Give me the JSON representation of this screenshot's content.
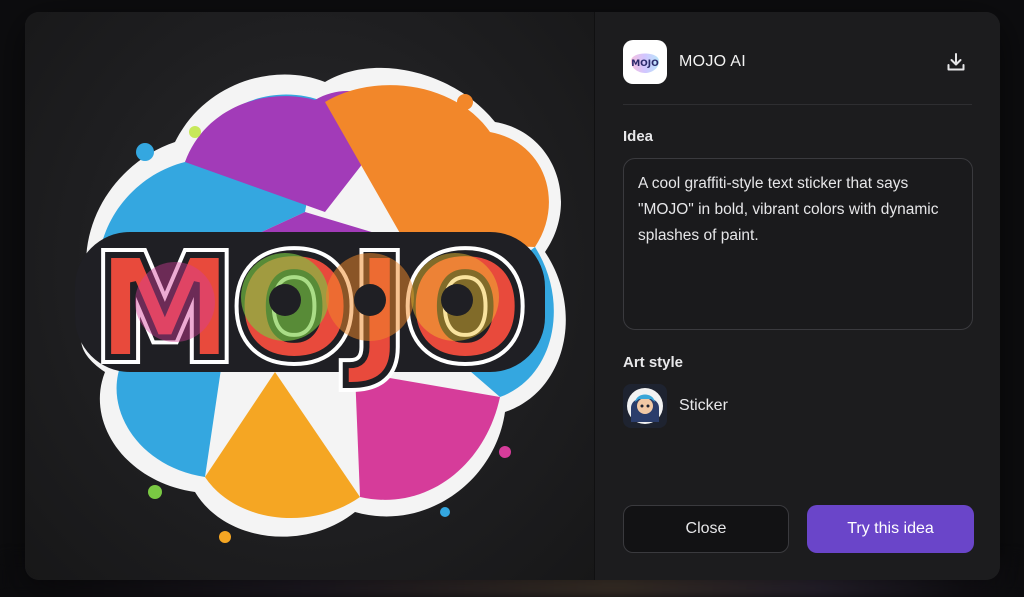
{
  "preview": {
    "text": "MOJO"
  },
  "app": {
    "name": "MOJO AI",
    "logo_text": "MOJO"
  },
  "download": {
    "icon": "download-icon"
  },
  "idea": {
    "label": "Idea",
    "text": "A cool graffiti-style text sticker that says \"MOJO\" in bold, vibrant colors with dynamic splashes of paint."
  },
  "art_style": {
    "label": "Art style",
    "value": "Sticker"
  },
  "buttons": {
    "close": "Close",
    "try": "Try this idea"
  },
  "colors": {
    "accent": "#6a45c9",
    "panel": "#1c1c1e"
  }
}
